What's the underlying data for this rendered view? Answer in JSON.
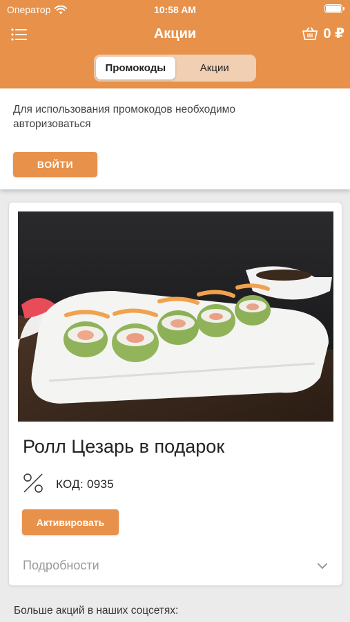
{
  "status_bar": {
    "carrier": "Оператор",
    "time": "10:58 AM"
  },
  "navbar": {
    "title": "Акции",
    "cart_total": "0 ₽"
  },
  "tabs": [
    {
      "label": "Промокоды",
      "active": true
    },
    {
      "label": "Акции",
      "active": false
    }
  ],
  "auth": {
    "message": "Для использования промокодов необходимо авторизоваться",
    "login_button": "ВОЙТИ"
  },
  "promo": {
    "title": "Ролл Цезарь в подарок",
    "code": "КОД: 0935",
    "activate_button": "Активировать",
    "details_label": "Подробности"
  },
  "footer": {
    "social_text": "Больше акций в наших соцсетях:"
  },
  "colors": {
    "accent": "#e8914a",
    "tab_track": "#f1cfb3",
    "background": "#ebebeb"
  },
  "icons": [
    "wifi-icon",
    "battery-icon",
    "menu-icon",
    "cart-icon",
    "percent-icon",
    "chevron-down-icon"
  ]
}
